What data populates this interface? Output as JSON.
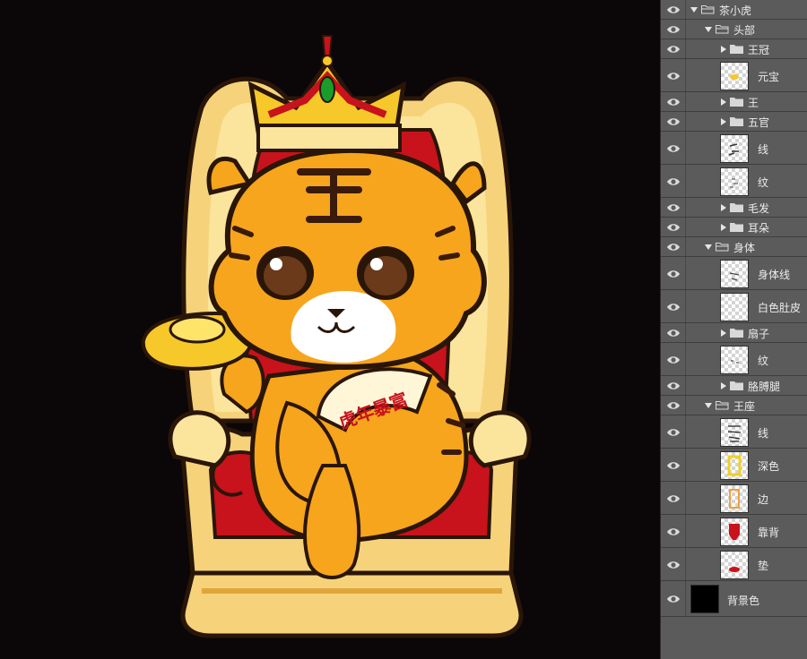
{
  "canvas": {
    "background_color": "#0b0608",
    "fan_text": "虎年暴富"
  },
  "layers_panel": {
    "rows": [
      {
        "type": "group",
        "expanded": true,
        "indent": 0,
        "label": "茶小虎"
      },
      {
        "type": "group",
        "expanded": true,
        "indent": 1,
        "label": "头部"
      },
      {
        "type": "group",
        "expanded": false,
        "indent": 2,
        "label": "王冠"
      },
      {
        "type": "layer",
        "indent": 2,
        "label": "元宝",
        "thumb": "yuanbao"
      },
      {
        "type": "group",
        "expanded": false,
        "indent": 2,
        "label": "王"
      },
      {
        "type": "group",
        "expanded": false,
        "indent": 2,
        "label": "五官"
      },
      {
        "type": "layer",
        "indent": 2,
        "label": "线",
        "thumb": "lines"
      },
      {
        "type": "layer",
        "indent": 2,
        "label": "纹",
        "thumb": "stripes"
      },
      {
        "type": "group",
        "expanded": false,
        "indent": 2,
        "label": "毛发"
      },
      {
        "type": "group",
        "expanded": false,
        "indent": 2,
        "label": "耳朵"
      },
      {
        "type": "group",
        "expanded": true,
        "indent": 1,
        "label": "身体"
      },
      {
        "type": "layer",
        "indent": 2,
        "label": "身体线",
        "thumb": "bodylines"
      },
      {
        "type": "layer",
        "indent": 2,
        "label": "白色肚皮",
        "thumb": "belly"
      },
      {
        "type": "group",
        "expanded": false,
        "indent": 2,
        "label": "扇子"
      },
      {
        "type": "layer",
        "indent": 2,
        "label": "纹",
        "thumb": "stripes2"
      },
      {
        "type": "group",
        "expanded": false,
        "indent": 2,
        "label": "胳膊腿"
      },
      {
        "type": "group",
        "expanded": true,
        "indent": 1,
        "label": "王座"
      },
      {
        "type": "layer",
        "indent": 2,
        "label": "线",
        "thumb": "throne-lines"
      },
      {
        "type": "layer",
        "indent": 2,
        "label": "深色",
        "thumb": "throne-dark"
      },
      {
        "type": "layer",
        "indent": 2,
        "label": "边",
        "thumb": "throne-edge"
      },
      {
        "type": "layer",
        "indent": 2,
        "label": "靠背",
        "thumb": "backrest"
      },
      {
        "type": "layer",
        "indent": 2,
        "label": "垫",
        "thumb": "cushion"
      },
      {
        "type": "layer",
        "indent": 0,
        "label": "背景色",
        "thumb": "solid-black"
      }
    ]
  }
}
